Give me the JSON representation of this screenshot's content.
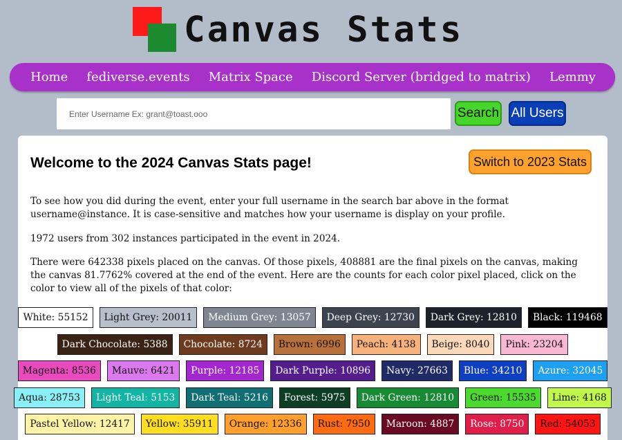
{
  "header": {
    "title": "Canvas Stats"
  },
  "nav": {
    "items": [
      {
        "label": "Home"
      },
      {
        "label": "fediverse.events"
      },
      {
        "label": "Matrix Space"
      },
      {
        "label": "Discord Server (bridged to matrix)"
      },
      {
        "label": "Lemmy"
      }
    ]
  },
  "search": {
    "placeholder": "Enter Username Ex: grant@toast.ooo",
    "search_label": "Search",
    "all_users_label": "All Users"
  },
  "main": {
    "heading": "Welcome to the 2024 Canvas Stats page!",
    "switch_label": "Switch to 2023 Stats",
    "intro": "To see how you did during the event, enter your full username in the search bar above in the format username@instance. It is case-sensitive and matches how your username is display on your profile.",
    "participants": "1972 users from 302 instances participated in the event in 2024.",
    "pixels": "There were 642338 pixels placed on the canvas. Of those pixels, 408881 are the final pixels on the canvas, making the canvas 81.7762% covered at the end of the event. Here are the counts for each color pixel placed, click on the color to view all of the pixels of that color:"
  },
  "colors": [
    [
      {
        "label": "White: 55152",
        "bg": "#ffffff",
        "fg": "#111111"
      },
      {
        "label": "Light Grey: 20011",
        "bg": "#b7bfcc",
        "fg": "#111111"
      },
      {
        "label": "Medium Grey: 13057",
        "bg": "#7f8692",
        "fg": "#ffffff"
      },
      {
        "label": "Deep Grey: 12730",
        "bg": "#3d4450",
        "fg": "#ffffff"
      },
      {
        "label": "Dark Grey: 12810",
        "bg": "#1d212b",
        "fg": "#ffffff"
      },
      {
        "label": "Black: 119468",
        "bg": "#000000",
        "fg": "#ffffff"
      }
    ],
    [
      {
        "label": "Dark Chocolate: 5388",
        "bg": "#3a2214",
        "fg": "#ffffff"
      },
      {
        "label": "Chocolate: 8724",
        "bg": "#6f3b1e",
        "fg": "#ffffff"
      },
      {
        "label": "Brown: 6996",
        "bg": "#b9713c",
        "fg": "#111111"
      },
      {
        "label": "Peach: 4138",
        "bg": "#f7b27c",
        "fg": "#111111"
      },
      {
        "label": "Beige: 8040",
        "bg": "#fad8b8",
        "fg": "#111111"
      },
      {
        "label": "Pink: 23204",
        "bg": "#f9b8d2",
        "fg": "#111111"
      }
    ],
    [
      {
        "label": "Magenta: 8536",
        "bg": "#e94bbf",
        "fg": "#111111"
      },
      {
        "label": "Mauve: 6421",
        "bg": "#dc79ee",
        "fg": "#111111"
      },
      {
        "label": "Purple: 12185",
        "bg": "#a326ce",
        "fg": "#ffffff"
      },
      {
        "label": "Dark Purple: 10896",
        "bg": "#541d8e",
        "fg": "#ffffff"
      },
      {
        "label": "Navy: 27663",
        "bg": "#1f2b66",
        "fg": "#ffffff"
      },
      {
        "label": "Blue: 34210",
        "bg": "#0e3fc0",
        "fg": "#ffffff"
      },
      {
        "label": "Azure: 32045",
        "bg": "#1e9ff0",
        "fg": "#ffffff"
      }
    ],
    [
      {
        "label": "Aqua: 28753",
        "bg": "#8af0f8",
        "fg": "#111111"
      },
      {
        "label": "Light Teal: 5153",
        "bg": "#12b5a4",
        "fg": "#ffffff"
      },
      {
        "label": "Dark Teal: 5216",
        "bg": "#0f6f73",
        "fg": "#ffffff"
      },
      {
        "label": "Forest: 5975",
        "bg": "#0d3f24",
        "fg": "#ffffff"
      },
      {
        "label": "Dark Green: 12810",
        "bg": "#178b34",
        "fg": "#ffffff"
      },
      {
        "label": "Green: 15535",
        "bg": "#4ad92c",
        "fg": "#111111"
      },
      {
        "label": "Lime: 4168",
        "bg": "#c0f74a",
        "fg": "#111111"
      }
    ],
    [
      {
        "label": "Pastel Yellow: 12417",
        "bg": "#fff3a8",
        "fg": "#111111"
      },
      {
        "label": "Yellow: 35911",
        "bg": "#ffde1f",
        "fg": "#111111"
      },
      {
        "label": "Orange: 12336",
        "bg": "#ffa02e",
        "fg": "#111111"
      },
      {
        "label": "Rust: 7950",
        "bg": "#ff6b10",
        "fg": "#111111"
      },
      {
        "label": "Maroon: 4887",
        "bg": "#6b0823",
        "fg": "#ffffff"
      },
      {
        "label": "Rose: 8750",
        "bg": "#e01e49",
        "fg": "#ffffff"
      },
      {
        "label": "Red: 54053",
        "bg": "#ff1313",
        "fg": "#111111"
      }
    ]
  ]
}
